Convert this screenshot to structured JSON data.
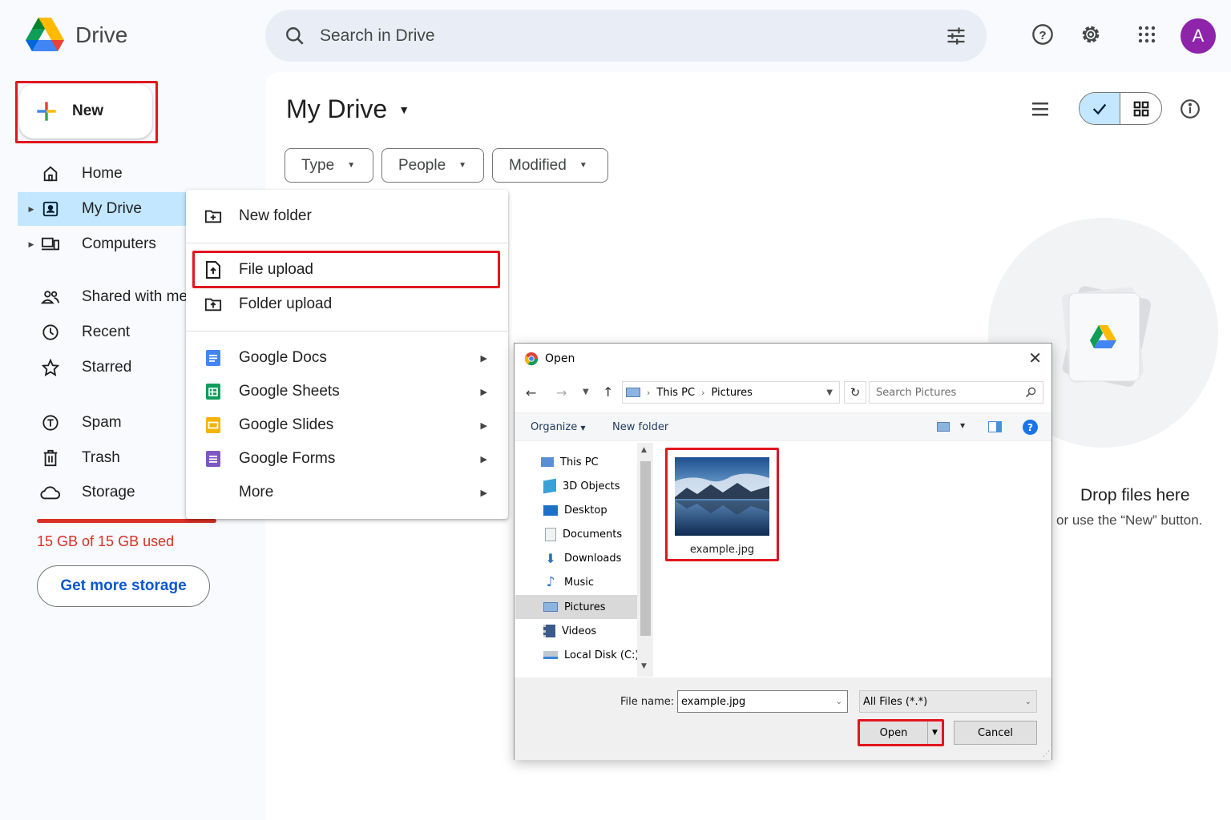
{
  "header": {
    "app_name": "Drive",
    "search_placeholder": "Search in Drive",
    "avatar_letter": "A"
  },
  "sidebar": {
    "new_label": "New",
    "items": [
      {
        "label": "Home",
        "icon": "home-icon"
      },
      {
        "label": "My Drive",
        "icon": "my-drive-icon",
        "active": true
      },
      {
        "label": "Computers",
        "icon": "computer-icon"
      },
      {
        "label": "Shared with me",
        "icon": "people-icon"
      },
      {
        "label": "Recent",
        "icon": "clock-icon"
      },
      {
        "label": "Starred",
        "icon": "star-icon"
      },
      {
        "label": "Spam",
        "icon": "spam-icon"
      },
      {
        "label": "Trash",
        "icon": "trash-icon"
      },
      {
        "label": "Storage",
        "icon": "cloud-icon"
      }
    ],
    "storage_used_fraction": 1.0,
    "storage_text": "15 GB of 15 GB used",
    "get_storage_label": "Get more storage"
  },
  "main": {
    "title": "My Drive",
    "filters": [
      "Type",
      "People",
      "Modified"
    ],
    "drop_title": "Drop files here",
    "drop_subtitle": "or use the “New” button."
  },
  "new_menu": {
    "items": [
      {
        "label": "New folder",
        "icon": "new-folder-icon"
      },
      {
        "label": "File upload",
        "icon": "file-upload-icon"
      },
      {
        "label": "Folder upload",
        "icon": "folder-upload-icon"
      },
      {
        "label": "Google Docs",
        "icon": "google-docs-icon",
        "submenu": true
      },
      {
        "label": "Google Sheets",
        "icon": "google-sheets-icon",
        "submenu": true
      },
      {
        "label": "Google Slides",
        "icon": "google-slides-icon",
        "submenu": true
      },
      {
        "label": "Google Forms",
        "icon": "google-forms-icon",
        "submenu": true
      },
      {
        "label": "More",
        "submenu": true
      }
    ]
  },
  "dialog": {
    "title": "Open",
    "breadcrumb": [
      "This PC",
      "Pictures"
    ],
    "search_placeholder": "Search Pictures",
    "organize_label": "Organize",
    "new_folder_label": "New folder",
    "tree": [
      "This PC",
      "3D Objects",
      "Desktop",
      "Documents",
      "Downloads",
      "Music",
      "Pictures",
      "Videos",
      "Local Disk (C:)"
    ],
    "selected_tree": "Pictures",
    "file": {
      "name": "example.jpg"
    },
    "file_name_label": "File name:",
    "file_name_value": "example.jpg",
    "file_type": "All Files (*.*)",
    "open_label": "Open",
    "cancel_label": "Cancel"
  },
  "colors": {
    "accent_blue": "#0b57d0",
    "selected_nav": "#c2e7ff",
    "highlight_red": "#e1161e",
    "storage_red": "#d93025"
  }
}
